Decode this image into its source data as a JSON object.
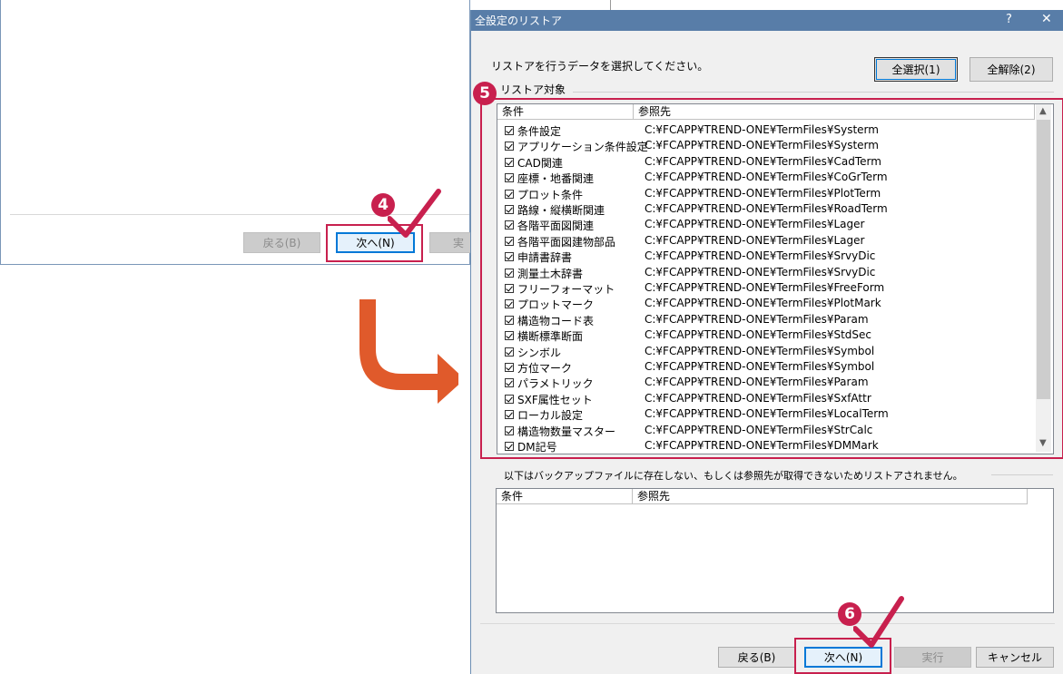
{
  "background_window": {
    "back_label": "戻る(B)",
    "next_label": "次へ(N)",
    "execute_label_partial": "実"
  },
  "dialog": {
    "title": "全設定のリストア",
    "help_label": "?",
    "close_label": "✕",
    "instruction": "リストアを行うデータを選択してください。",
    "select_all_label": "全選択(1)",
    "clear_all_label": "全解除(2)",
    "group_label": "リストア対象",
    "columns": {
      "condition": "条件",
      "reference": "参照先"
    },
    "items": [
      {
        "condition": "条件設定",
        "reference": "C:¥FCAPP¥TREND-ONE¥TermFiles¥Systerm"
      },
      {
        "condition": "アプリケーション条件設定",
        "reference": "C:¥FCAPP¥TREND-ONE¥TermFiles¥Systerm"
      },
      {
        "condition": "CAD関連",
        "reference": "C:¥FCAPP¥TREND-ONE¥TermFiles¥CadTerm"
      },
      {
        "condition": "座標・地番関連",
        "reference": "C:¥FCAPP¥TREND-ONE¥TermFiles¥CoGrTerm"
      },
      {
        "condition": "プロット条件",
        "reference": "C:¥FCAPP¥TREND-ONE¥TermFiles¥PlotTerm"
      },
      {
        "condition": "路線・縦横断関連",
        "reference": "C:¥FCAPP¥TREND-ONE¥TermFiles¥RoadTerm"
      },
      {
        "condition": "各階平面図関連",
        "reference": "C:¥FCAPP¥TREND-ONE¥TermFiles¥Lager"
      },
      {
        "condition": "各階平面図建物部品",
        "reference": "C:¥FCAPP¥TREND-ONE¥TermFiles¥Lager"
      },
      {
        "condition": "申請書辞書",
        "reference": "C:¥FCAPP¥TREND-ONE¥TermFiles¥SrvyDic"
      },
      {
        "condition": "測量土木辞書",
        "reference": "C:¥FCAPP¥TREND-ONE¥TermFiles¥SrvyDic"
      },
      {
        "condition": "フリーフォーマット",
        "reference": "C:¥FCAPP¥TREND-ONE¥TermFiles¥FreeForm"
      },
      {
        "condition": "プロットマーク",
        "reference": "C:¥FCAPP¥TREND-ONE¥TermFiles¥PlotMark"
      },
      {
        "condition": "構造物コード表",
        "reference": "C:¥FCAPP¥TREND-ONE¥TermFiles¥Param"
      },
      {
        "condition": "横断標準断面",
        "reference": "C:¥FCAPP¥TREND-ONE¥TermFiles¥StdSec"
      },
      {
        "condition": "シンボル",
        "reference": "C:¥FCAPP¥TREND-ONE¥TermFiles¥Symbol"
      },
      {
        "condition": "方位マーク",
        "reference": "C:¥FCAPP¥TREND-ONE¥TermFiles¥Symbol"
      },
      {
        "condition": "パラメトリック",
        "reference": "C:¥FCAPP¥TREND-ONE¥TermFiles¥Param"
      },
      {
        "condition": "SXF属性セット",
        "reference": "C:¥FCAPP¥TREND-ONE¥TermFiles¥SxfAttr"
      },
      {
        "condition": "ローカル設定",
        "reference": "C:¥FCAPP¥TREND-ONE¥TermFiles¥LocalTerm"
      },
      {
        "condition": "構造物数量マスター",
        "reference": "C:¥FCAPP¥TREND-ONE¥TermFiles¥StrCalc"
      },
      {
        "condition": "DM記号",
        "reference": "C:¥FCAPP¥TREND-ONE¥TermFiles¥DMMark"
      }
    ],
    "not_restored_notice": "以下はバックアップファイルに存在しない、もしくは参照先が取得できないためリストアされません。",
    "footer": {
      "back_label": "戻る(B)",
      "next_label": "次へ(N)",
      "execute_label": "実行",
      "cancel_label": "キャンセル"
    }
  },
  "annotations": {
    "step4": "4",
    "step5": "5",
    "step6": "6",
    "accent_color": "#c8204e",
    "arrow_color": "#e05a2b"
  }
}
